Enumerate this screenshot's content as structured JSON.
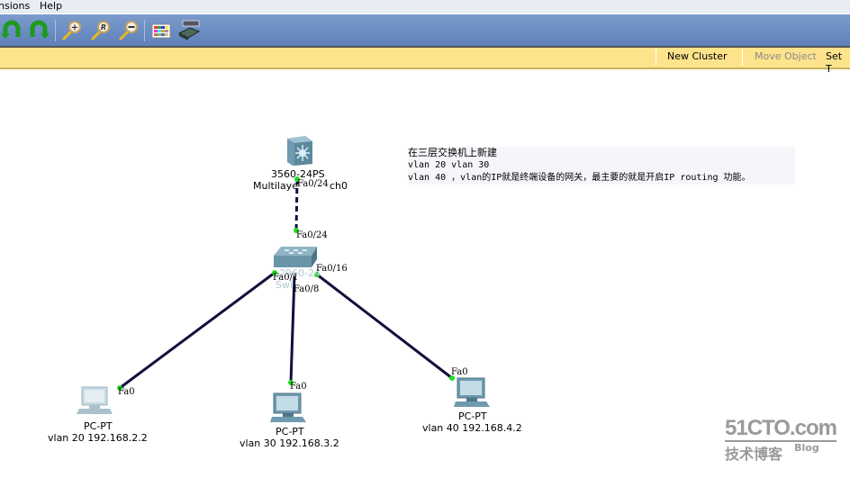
{
  "menubar": {
    "items": [
      "nsions",
      "Help"
    ]
  },
  "toolbar": {
    "buttons": [
      "undo-icon",
      "redo-icon",
      "zoom-in-icon",
      "zoom-reset-icon",
      "zoom-out-icon",
      "palette-icon",
      "device-dialog-icon"
    ]
  },
  "workspace_bar": {
    "new_cluster": "New Cluster",
    "move_object": "Move Object",
    "set_tiled": "Set T"
  },
  "devices": {
    "multilayer_switch": {
      "model": "3560-24PS",
      "name": "Multilayer Switch0",
      "name_visible": "Multilaye",
      "name_tail": "ch0",
      "port": "Fa0/24"
    },
    "switch": {
      "model_partial": "2960-24TT",
      "name": "Switch0",
      "port_up": "Fa0/24",
      "port_left": "Fa0/1",
      "port_mid": "Fa0/8",
      "port_right": "Fa0/16",
      "label_obscured_1": "2960-24",
      "label_obscured_2": "Swi"
    },
    "pcs": [
      {
        "type": "PC-PT",
        "label": "vlan 20 192.168.2.2",
        "port": "Fa0"
      },
      {
        "type": "PC-PT",
        "label": "vlan 30 192.168.3.2",
        "port": "Fa0"
      },
      {
        "type": "PC-PT",
        "label": "vlan 40 192.168.4.2",
        "port": "Fa0"
      }
    ]
  },
  "note": {
    "line1": "在三层交换机上新建",
    "line2": "vlan 20  vlan 30",
    "line3": "vlan 40 ，vlan的IP就是终端设备的网关，最主要的就是开启IP routing 功能。"
  },
  "watermark": {
    "brand": "51CTO.com",
    "sub": "技术博客",
    "blog": "Blog"
  },
  "colors": {
    "link_up": "#22dd22",
    "cable": "#10103a",
    "toolbar": "#6b8fc4",
    "workspace_bar": "#fde38c"
  }
}
